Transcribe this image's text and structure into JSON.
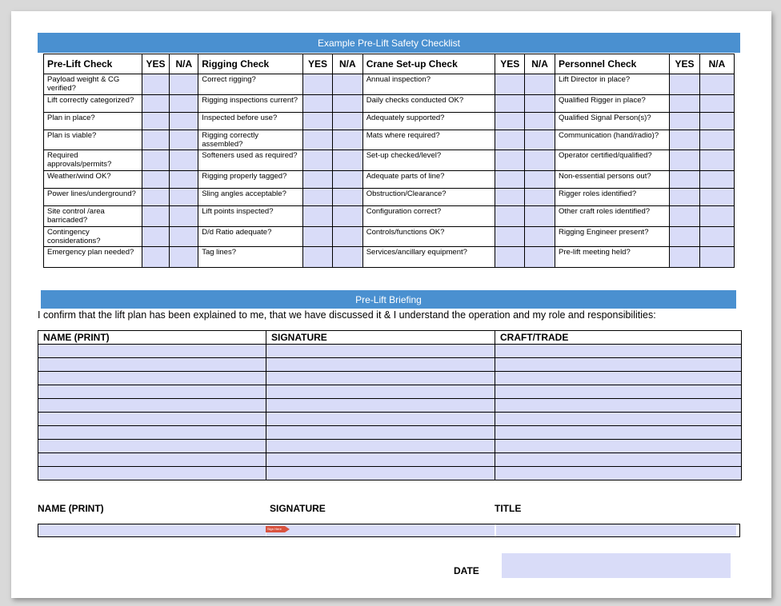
{
  "checklist": {
    "title": "Example Pre-Lift Safety Checklist",
    "yes_label": "YES",
    "na_label": "N/A",
    "sections": [
      "Pre-Lift Check",
      "Rigging Check",
      "Crane Set-up Check",
      "Personnel Check"
    ],
    "rows": [
      [
        "Payload weight & CG verified?",
        "Correct rigging?",
        "Annual inspection?",
        "Lift Director in place?"
      ],
      [
        "Lift correctly categorized?",
        "Rigging inspections current?",
        "Daily checks conducted OK?",
        "Qualified Rigger in place?"
      ],
      [
        "Plan in place?",
        "Inspected before use?",
        "Adequately supported?",
        "Qualified Signal Person(s)?"
      ],
      [
        "Plan is viable?",
        "Rigging correctly assembled?",
        "Mats where required?",
        "Communication (hand/radio)?"
      ],
      [
        "Required approvals/permits?",
        "Softeners used as required?",
        "Set-up checked/level?",
        "Operator certified/qualified?"
      ],
      [
        "Weather/wind OK?",
        "Rigging properly tagged?",
        "Adequate parts of line?",
        "Non-essential persons out?"
      ],
      [
        "Power lines/underground?",
        "Sling angles acceptable?",
        "Obstruction/Clearance?",
        "Rigger roles identified?"
      ],
      [
        "Site control /area barricaded?",
        "Lift points inspected?",
        "Configuration correct?",
        "Other craft roles identified?"
      ],
      [
        "Contingency considerations?",
        "D/d Ratio adequate?",
        "Controls/functions OK?",
        "Rigging Engineer present?"
      ],
      [
        "Emergency plan needed?",
        "Tag lines?",
        "Services/ancillary equipment?",
        "Pre-lift meeting held?"
      ]
    ]
  },
  "briefing": {
    "title": "Pre-Lift Briefing",
    "confirmation": "I confirm that the lift plan has been explained to me, that we have discussed it & I understand the operation and my role and responsibilities:",
    "columns": [
      "NAME (PRINT)",
      "SIGNATURE",
      "CRAFT/TRADE"
    ],
    "blank_rows": 10
  },
  "signoff": {
    "name_label": "NAME (PRINT)",
    "signature_label": "SIGNATURE",
    "title_label": "TITLE",
    "date_label": "DATE",
    "marker_text": "Sign Here"
  },
  "colors": {
    "banner": "#4a90d0",
    "field_fill": "#d9dcf8",
    "marker": "#d9533f"
  }
}
